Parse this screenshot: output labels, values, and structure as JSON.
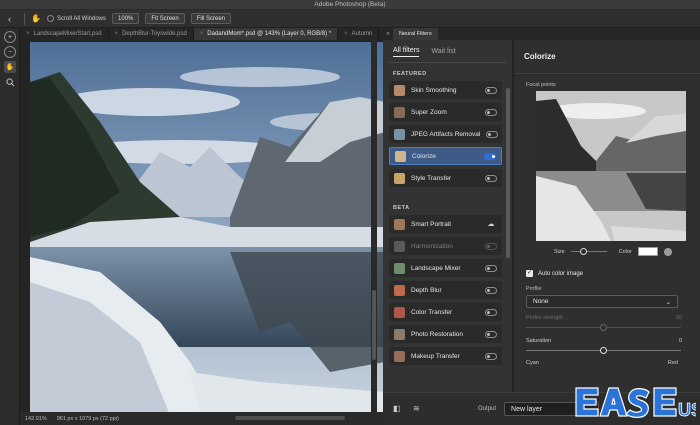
{
  "app": {
    "title": "Adobe Photoshop (Beta)"
  },
  "options_bar": {
    "scroll_all_windows": "Scroll All Windows",
    "zoom_100": "100%",
    "fit_screen": "Fit Screen",
    "fill_screen": "Fill Screen"
  },
  "doc_tabs": [
    {
      "label": "LandscapeMixerStart.psd",
      "active": false
    },
    {
      "label": "DepthBlur-Toyswide.psd",
      "active": false
    },
    {
      "label": "DadandMom*.psd @ 143% (Layer 0, RGB/8) *",
      "active": true
    },
    {
      "label": "Autumn",
      "active": false
    }
  ],
  "status_bar": {
    "zoom": "142.91%",
    "doc_info": "961 px x 1079 px (72 ppi)"
  },
  "panel_tab": "Neural Filters",
  "neural_filters": {
    "tabs": [
      {
        "label": "All filters",
        "active": true
      },
      {
        "label": "Wait list",
        "active": false
      }
    ],
    "featured_label": "FEATURED",
    "beta_label": "BETA",
    "featured": [
      {
        "name": "Skin Smoothing",
        "state": "off",
        "color": "#b98a6a"
      },
      {
        "name": "Super Zoom",
        "state": "off",
        "color": "#8a6b52"
      },
      {
        "name": "JPEG Artifacts Removal",
        "state": "off",
        "color": "#7a8fa8"
      },
      {
        "name": "Colorize",
        "state": "on",
        "color": "#d2b48c"
      },
      {
        "name": "Style Transfer",
        "state": "off",
        "color": "#c9a46a"
      }
    ],
    "beta": [
      {
        "name": "Smart Portrait",
        "state": "cloud",
        "color": "#a07658"
      },
      {
        "name": "Harmonization",
        "state": "disabled",
        "color": "#5a5a5a"
      },
      {
        "name": "Landscape Mixer",
        "state": "off",
        "color": "#6e8f6a"
      },
      {
        "name": "Depth Blur",
        "state": "off",
        "color": "#c06a4a"
      },
      {
        "name": "Color Transfer",
        "state": "off",
        "color": "#b0574a"
      },
      {
        "name": "Photo Restoration",
        "state": "off",
        "color": "#8b7b6b"
      },
      {
        "name": "Makeup Transfer",
        "state": "off",
        "color": "#9a6a5a"
      }
    ]
  },
  "properties": {
    "title": "Colorize",
    "focal_points_label": "Focal points",
    "size_label": "Size",
    "color_label": "Color",
    "size_value": 0.36,
    "auto_color_label": "Auto color image",
    "auto_color_checked": true,
    "profile_label": "Profile",
    "profile_value": "None",
    "profile_strength_label": "Profile strength",
    "profile_strength_value": "50",
    "saturation_label": "Saturation",
    "saturation_value": "0",
    "cyan_label": "Cyan",
    "red_label": "Red"
  },
  "output": {
    "label": "Output",
    "value": "New layer"
  },
  "watermark": "EaseUS"
}
